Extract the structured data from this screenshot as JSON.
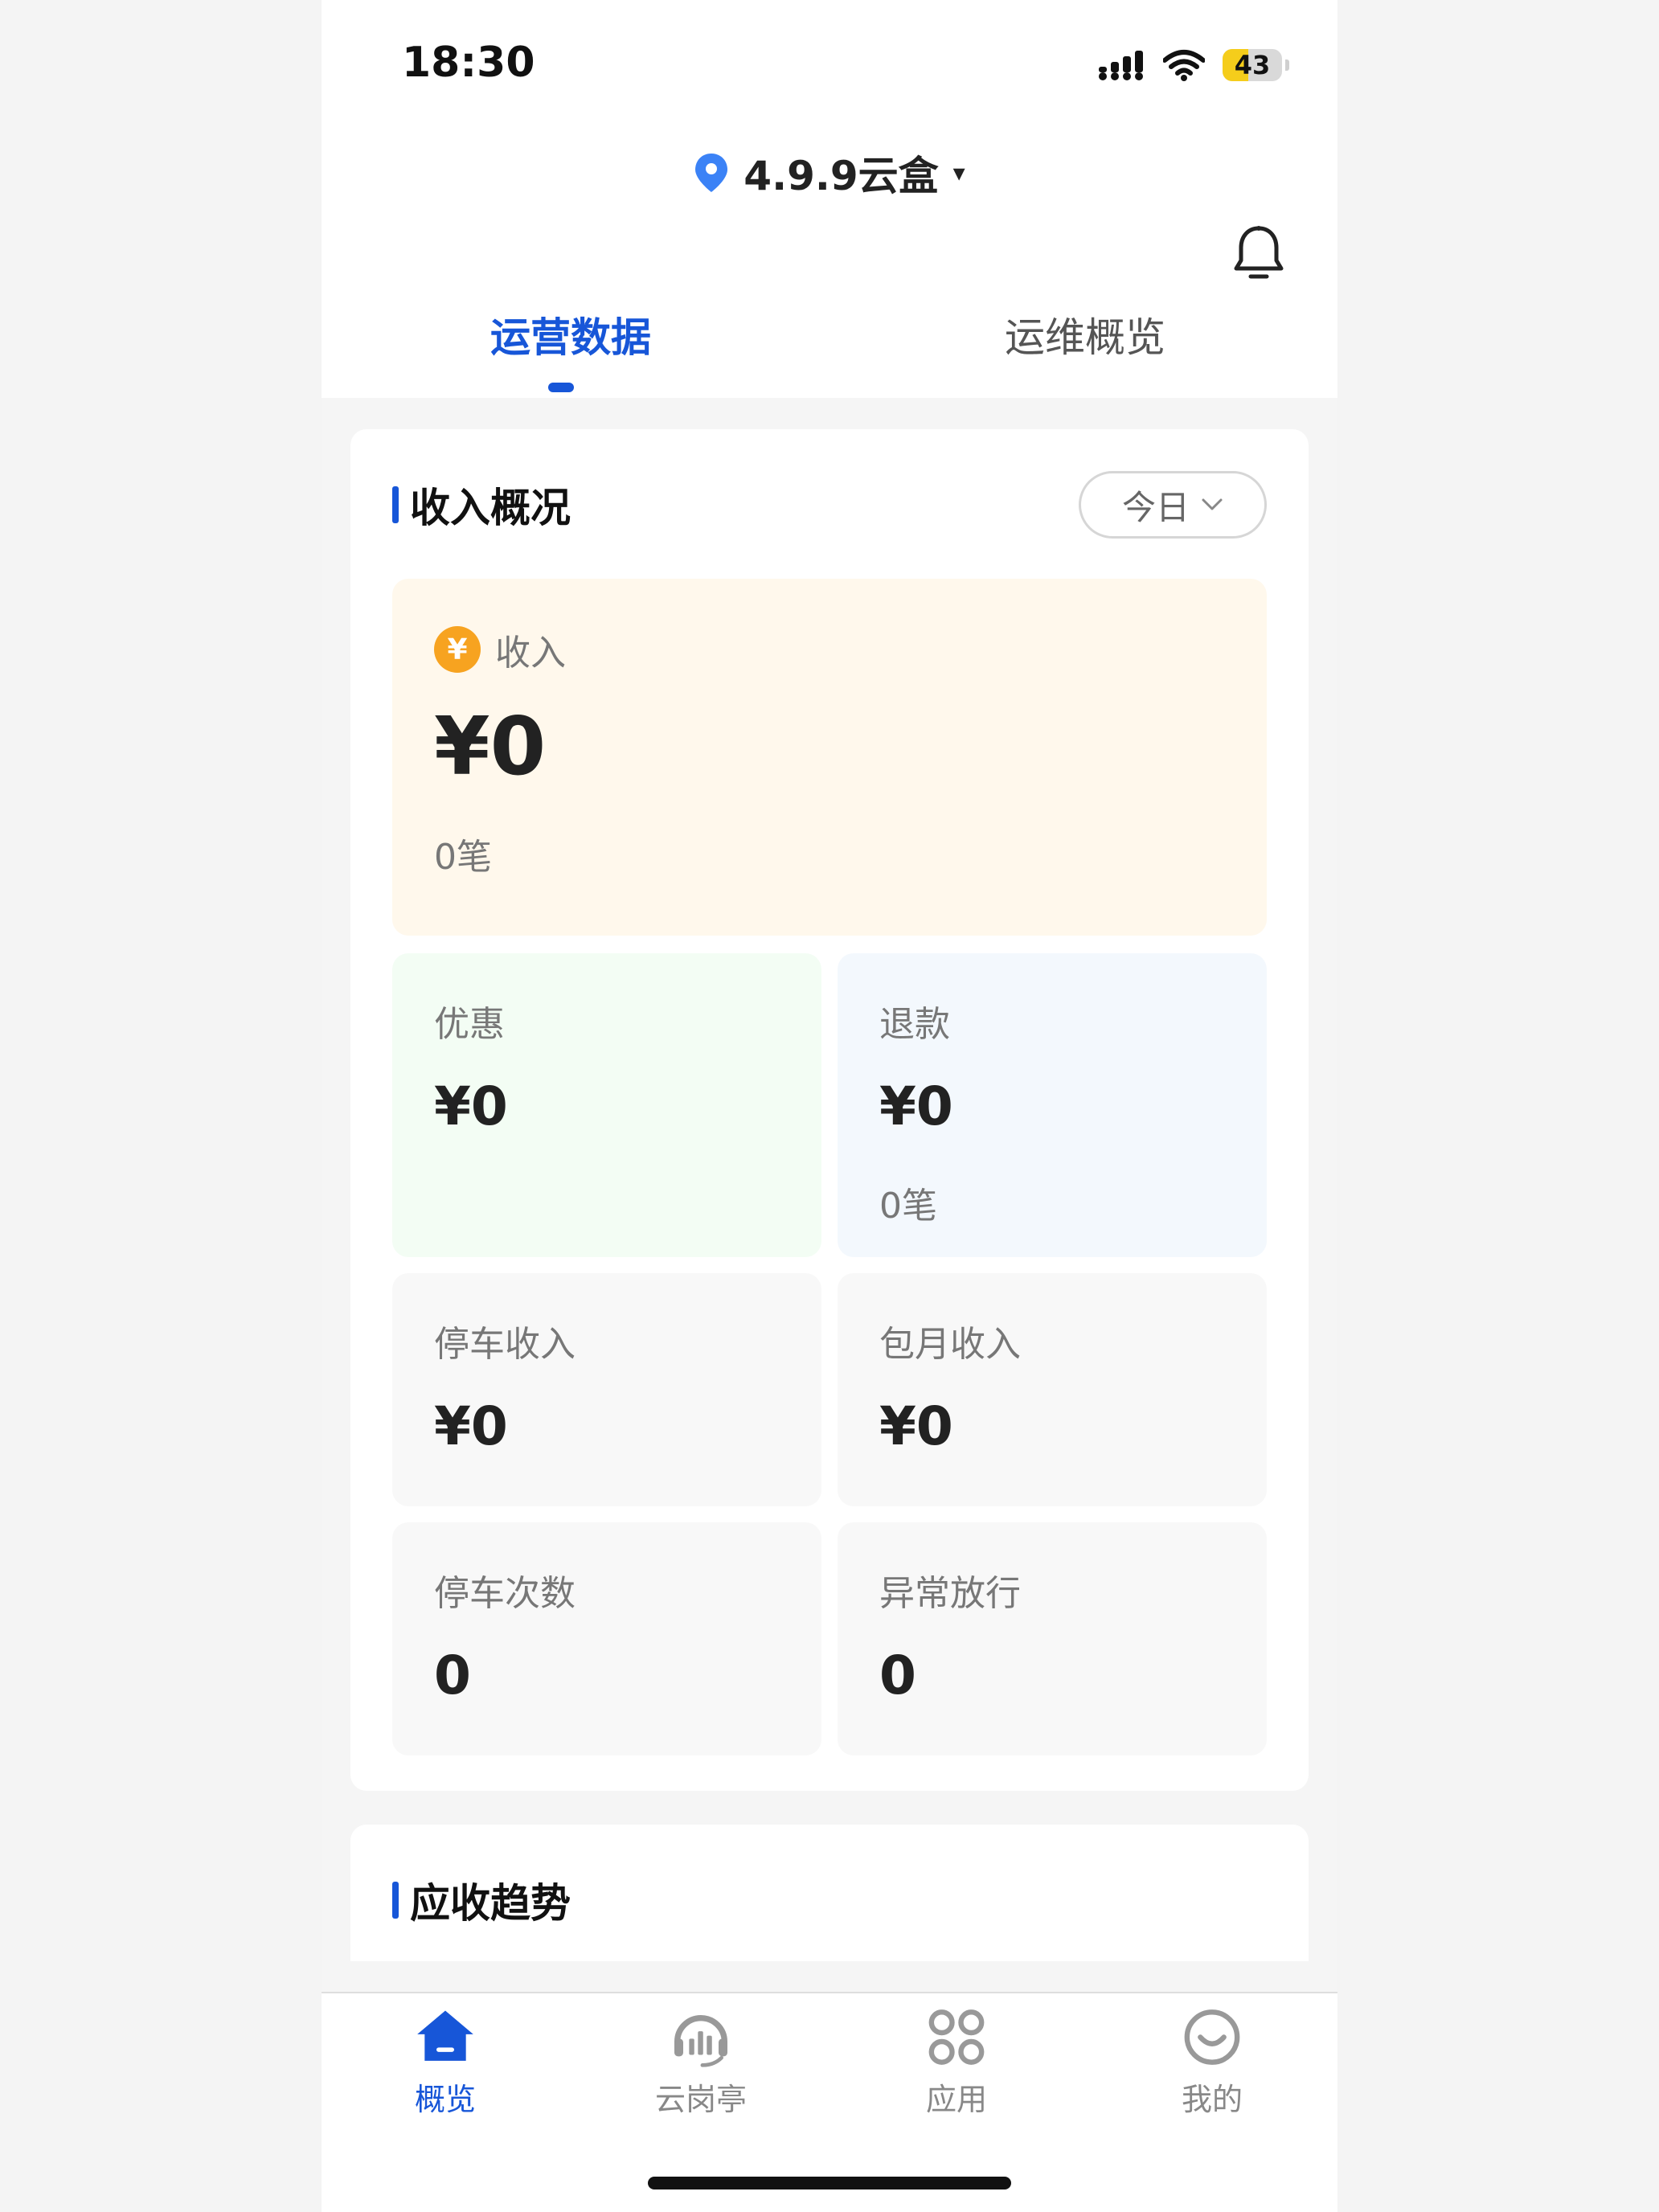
{
  "status_bar": {
    "time": "18:30",
    "battery_level": "43",
    "battery_fraction": 0.43
  },
  "header": {
    "location_name": "4.9.9云盒",
    "location_arrow": "▾"
  },
  "tabs": [
    {
      "label": "运营数据",
      "active": true
    },
    {
      "label": "运维概览",
      "active": false
    }
  ],
  "income_section": {
    "title": "收入概况",
    "period": "今日",
    "income": {
      "label": "收入",
      "icon": "¥",
      "value": "¥0",
      "count": "0笔"
    },
    "discount": {
      "label": "优惠",
      "value": "¥0"
    },
    "refund": {
      "label": "退款",
      "value": "¥0",
      "count": "0笔"
    },
    "parking_income": {
      "label": "停车收入",
      "value": "¥0"
    },
    "monthly_income": {
      "label": "包月收入",
      "value": "¥0"
    },
    "parking_count": {
      "label": "停车次数",
      "value": "0"
    },
    "abnormal_release": {
      "label": "异常放行",
      "value": "0"
    }
  },
  "trend_section": {
    "title": "应收趋势"
  },
  "bottom_nav": [
    {
      "label": "概览",
      "icon": "home-icon",
      "active": true
    },
    {
      "label": "云岗亭",
      "icon": "headset-chart-icon",
      "active": false
    },
    {
      "label": "应用",
      "icon": "apps-grid-icon",
      "active": false
    },
    {
      "label": "我的",
      "icon": "smile-icon",
      "active": false
    }
  ],
  "colors": {
    "accent": "#1756d8",
    "income_bg": "#fff8ec",
    "discount_bg": "#f3fdf4",
    "refund_bg": "#f3f8fd",
    "yen_orange": "#f7a320"
  }
}
